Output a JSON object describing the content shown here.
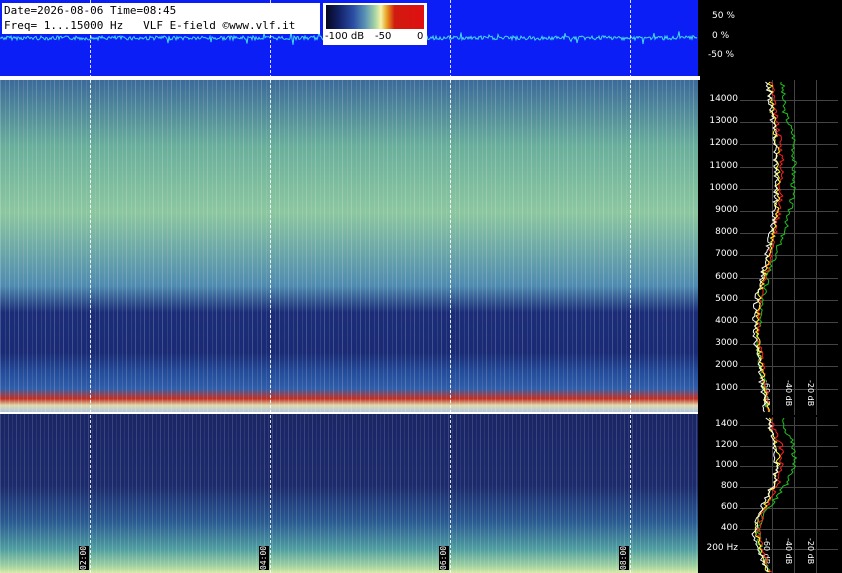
{
  "info_box": {
    "line1": "Date=2026-08-06 Time=08:45",
    "line2": "Freq= 1...15000 Hz   VLF E-field ©www.vlf.it"
  },
  "colorbar": {
    "labels": [
      "-100 dB",
      "-50",
      "0"
    ]
  },
  "waveform_scale": [
    "50 %",
    "0 %",
    "-50 %"
  ],
  "time_labels": [
    "02:00",
    "04:00",
    "06:00",
    "08:00"
  ],
  "freq_axis_high": [
    "14000",
    "13000",
    "12000",
    "11000",
    "10000",
    "9000",
    "8000",
    "7000",
    "6000",
    "5000",
    "4000",
    "3000",
    "2000",
    "1000"
  ],
  "freq_axis_low": [
    "1400",
    "1200",
    "1000",
    "800",
    "600",
    "400",
    "200 Hz"
  ],
  "db_labels": [
    "-60 dB",
    "-40 dB",
    "-20 dB"
  ],
  "colors": {
    "waveform_bg": "#0a1ef5",
    "waveform_trace": "#45d8f0",
    "trace_red": "#ff2020",
    "trace_yellow": "#ffff30",
    "trace_green": "#20c020",
    "trace_white": "#ffffff"
  }
}
